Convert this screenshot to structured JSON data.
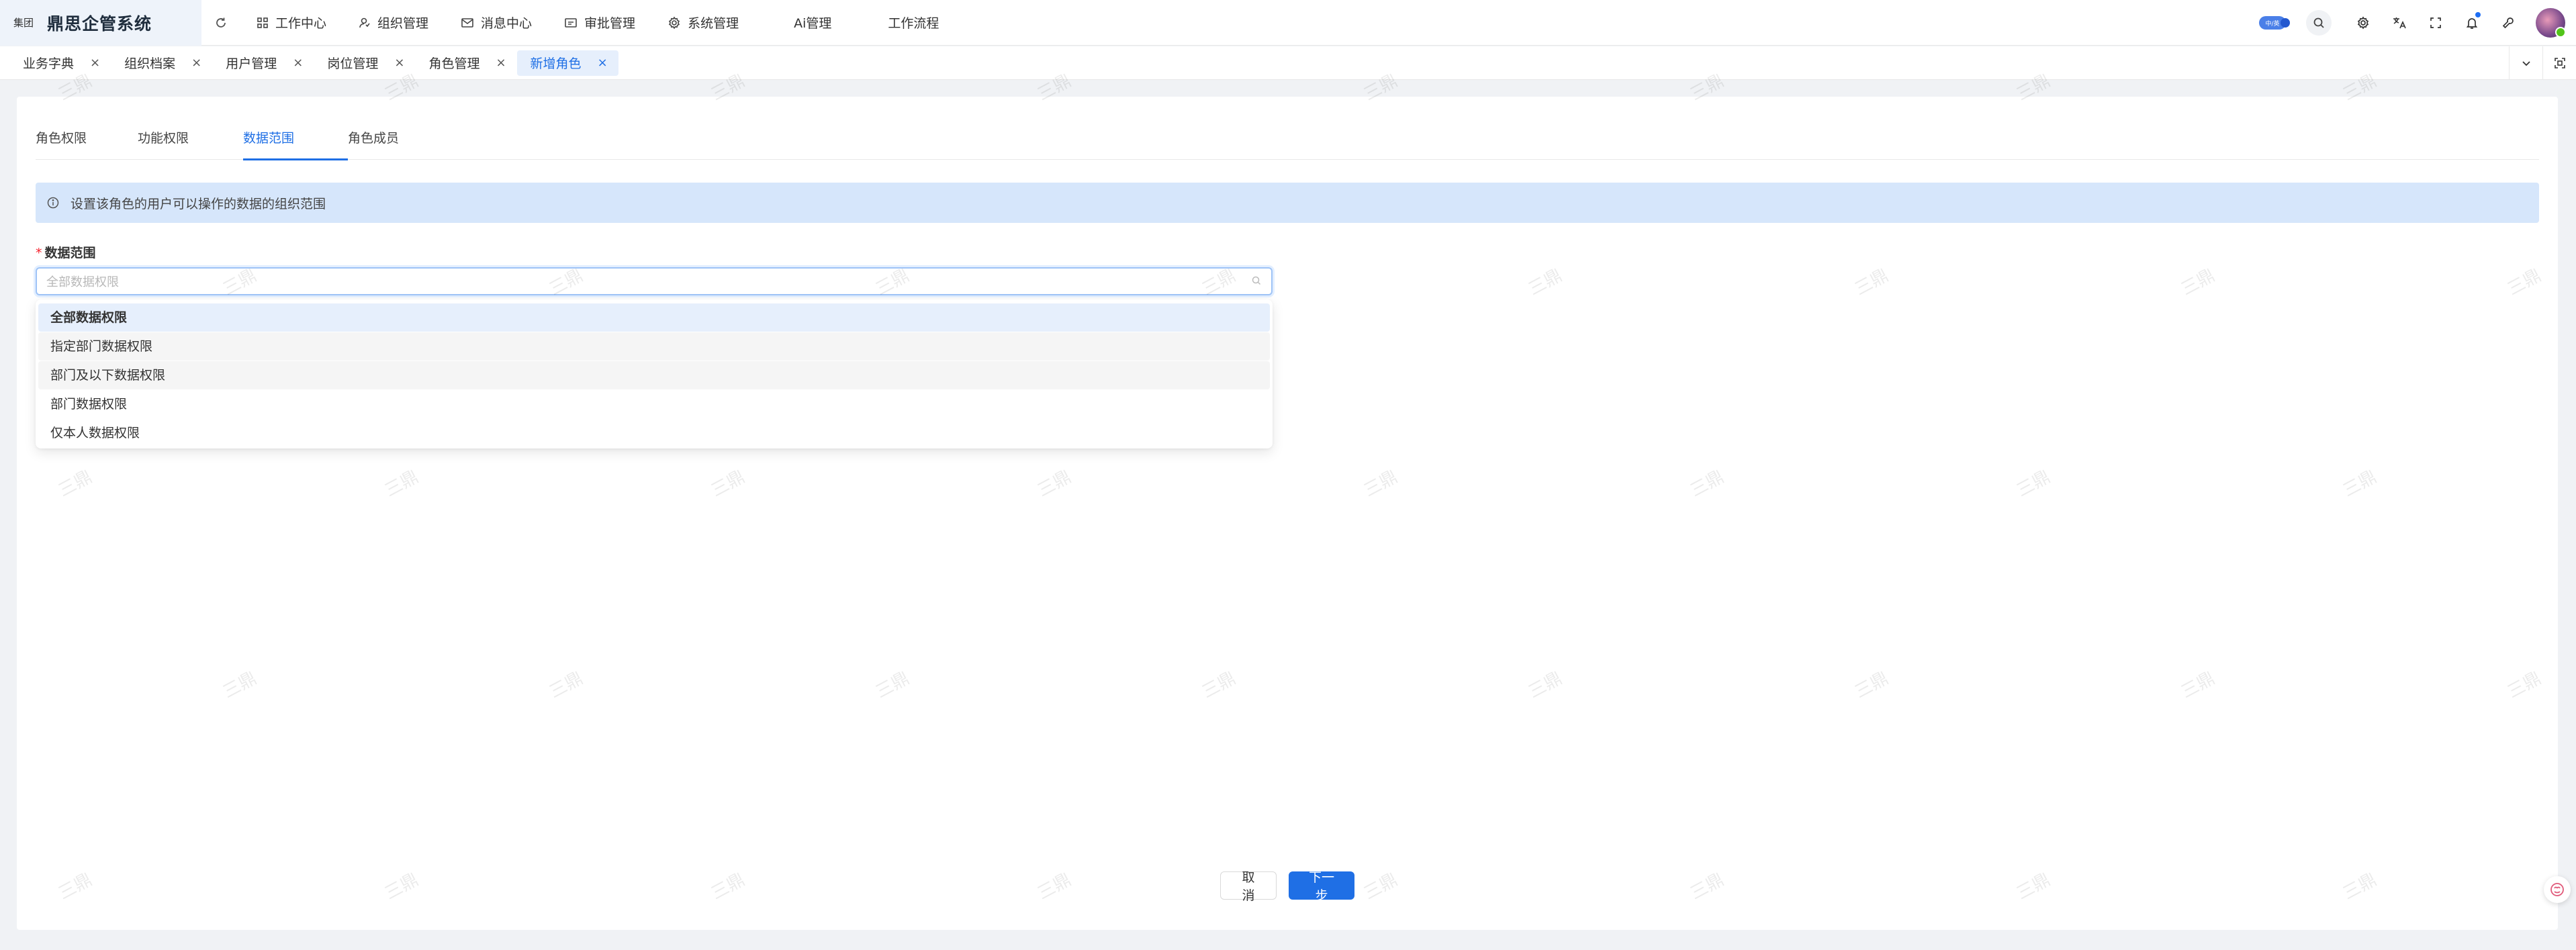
{
  "header": {
    "org_badge": "集团",
    "app_title": "鼎思企管系统",
    "nav": [
      {
        "label": "工作中心",
        "icon": "grid-icon"
      },
      {
        "label": "组织管理",
        "icon": "org-icon"
      },
      {
        "label": "消息中心",
        "icon": "mail-icon"
      },
      {
        "label": "审批管理",
        "icon": "approval-icon"
      },
      {
        "label": "系统管理",
        "icon": "gear-icon"
      },
      {
        "label": "Ai管理",
        "icon": ""
      },
      {
        "label": "工作流程",
        "icon": ""
      }
    ],
    "switch_label": "中/英"
  },
  "tabs": [
    {
      "label": "业务字典",
      "active": false
    },
    {
      "label": "组织档案",
      "active": false
    },
    {
      "label": "用户管理",
      "active": false
    },
    {
      "label": "岗位管理",
      "active": false
    },
    {
      "label": "角色管理",
      "active": false
    },
    {
      "label": "新增角色",
      "active": true
    }
  ],
  "steps": [
    {
      "label": "角色权限",
      "active": false
    },
    {
      "label": "功能权限",
      "active": false
    },
    {
      "label": "数据范围",
      "active": true
    },
    {
      "label": "角色成员",
      "active": false
    }
  ],
  "alert": {
    "text": "设置该角色的用户可以操作的数据的组织范围"
  },
  "form": {
    "label": "数据范围",
    "required_mark": "*",
    "placeholder": "全部数据权限",
    "options": [
      {
        "label": "全部数据权限",
        "selected": true
      },
      {
        "label": "指定部门数据权限",
        "selected": false
      },
      {
        "label": "部门及以下数据权限",
        "selected": false
      },
      {
        "label": "部门数据权限",
        "selected": false
      },
      {
        "label": "仅本人数据权限",
        "selected": false
      }
    ]
  },
  "actions": {
    "cancel": "取 消",
    "next": "下一步"
  },
  "watermark": "三鼎",
  "colors": {
    "primary": "#1f6fe5",
    "alert_bg": "#d6e6fb",
    "active_tab_bg": "#e6effc",
    "page_bg": "#f0f2f5"
  }
}
